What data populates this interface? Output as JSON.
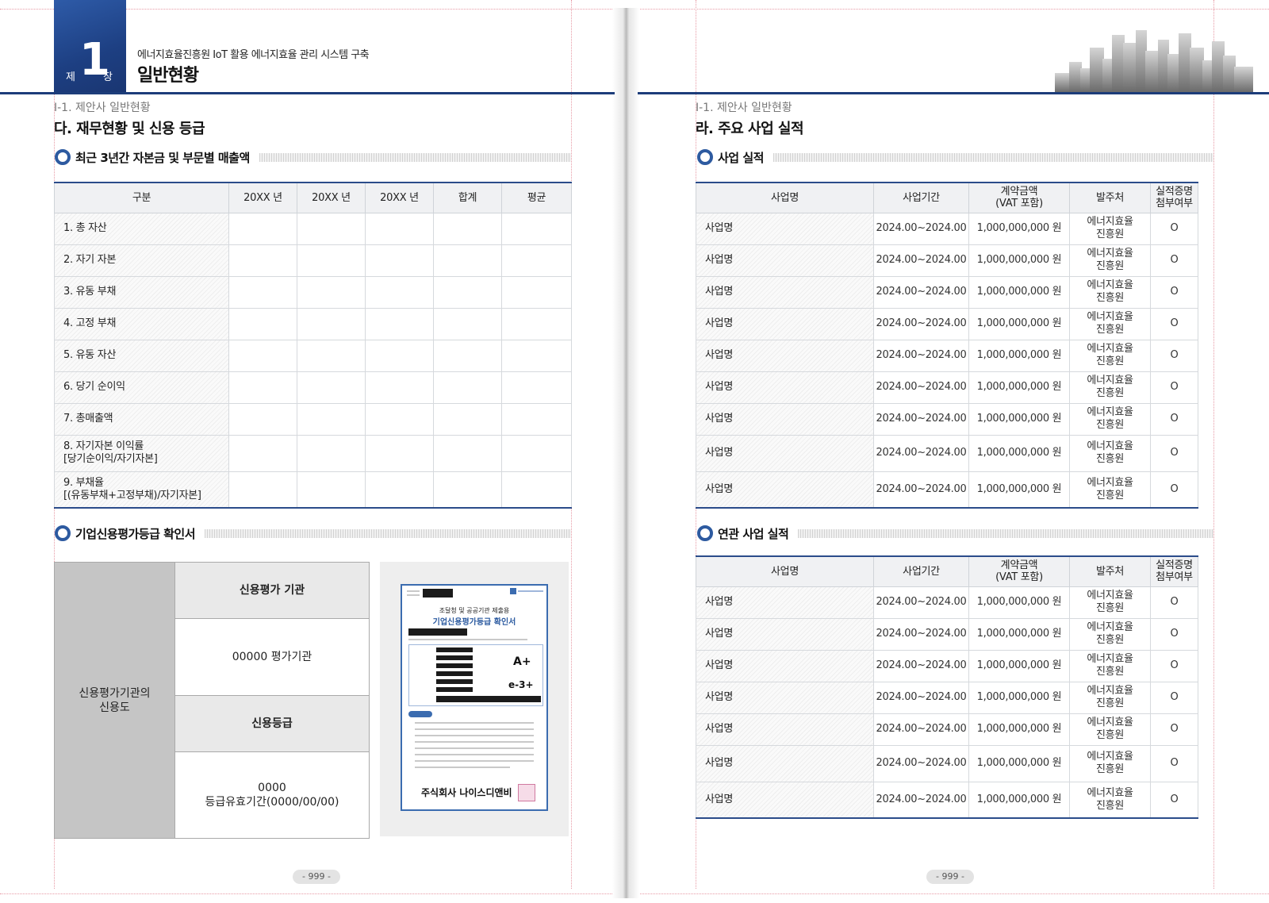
{
  "header": {
    "chapter_prefix": "제",
    "chapter_number": "1",
    "chapter_suffix": "장",
    "subtitle": "에너지효율진흥원  IoT 활용 에너지효율 관리 시스템 구축",
    "title": "일반현황"
  },
  "left": {
    "breadcrumb": "Ⅰ-1. 제안사 일반현황",
    "section_title": "다. 재무현황 및 신용 등급",
    "finance": {
      "heading": "최근 3년간 자본금 및 부문별 매출액",
      "columns": [
        "구분",
        "20XX 년",
        "20XX 년",
        "20XX 년",
        "합계",
        "평균"
      ],
      "rows": [
        {
          "l1": "1. 총 자산",
          "l2": ""
        },
        {
          "l1": "2. 자기 자본",
          "l2": ""
        },
        {
          "l1": "3. 유동 부채",
          "l2": ""
        },
        {
          "l1": "4. 고정 부채",
          "l2": ""
        },
        {
          "l1": "5. 유동 자산",
          "l2": ""
        },
        {
          "l1": "6. 당기 순이익",
          "l2": ""
        },
        {
          "l1": "7. 총매출액",
          "l2": ""
        },
        {
          "l1": "8. 자기자본 이익률",
          "l2": "[당기순이익/자기자본]"
        },
        {
          "l1": "9. 부채율",
          "l2": "[(유동부채+고정부채)/자기자본]"
        }
      ]
    },
    "credit": {
      "heading": "기업신용평가등급 확인서",
      "left_l1": "신용평가기관의",
      "left_l2": "신용도",
      "agency_head": "신용평가 기관",
      "agency_value": "00000 평가기관",
      "grade_head": "신용등급",
      "grade_l1": "0000",
      "grade_l2": "등급유효기간(0000/00/00)"
    },
    "certificate": {
      "title_line1": "조달청 및 공공기관 제출용",
      "title_line2": "기업신용평가등급 확인서",
      "grade1": "A+",
      "grade2": "e-3+",
      "company": "주식회사 나이스디앤비"
    },
    "page_number": "- 999 -"
  },
  "right": {
    "breadcrumb": "Ⅰ-1. 제안사 일반현황",
    "section_title": "라. 주요 사업 실적",
    "business": {
      "heading": "사업 실적",
      "columns": [
        {
          "l1": "사업명",
          "l2": ""
        },
        {
          "l1": "사업기간",
          "l2": ""
        },
        {
          "l1": "계약금액",
          "l2": "(VAT 포함)"
        },
        {
          "l1": "발주처",
          "l2": ""
        },
        {
          "l1": "실적증명",
          "l2": "첨부여부"
        }
      ],
      "rows": [
        {
          "name": "사업명",
          "period": "2024.00~2024.00",
          "amount": "1,000,000,000 원",
          "client_l1": "에너지효율",
          "client_l2": "진흥원",
          "attached": "O"
        },
        {
          "name": "사업명",
          "period": "2024.00~2024.00",
          "amount": "1,000,000,000 원",
          "client_l1": "에너지효율",
          "client_l2": "진흥원",
          "attached": "O"
        },
        {
          "name": "사업명",
          "period": "2024.00~2024.00",
          "amount": "1,000,000,000 원",
          "client_l1": "에너지효율",
          "client_l2": "진흥원",
          "attached": "O"
        },
        {
          "name": "사업명",
          "period": "2024.00~2024.00",
          "amount": "1,000,000,000 원",
          "client_l1": "에너지효율",
          "client_l2": "진흥원",
          "attached": "O"
        },
        {
          "name": "사업명",
          "period": "2024.00~2024.00",
          "amount": "1,000,000,000 원",
          "client_l1": "에너지효율",
          "client_l2": "진흥원",
          "attached": "O"
        },
        {
          "name": "사업명",
          "period": "2024.00~2024.00",
          "amount": "1,000,000,000 원",
          "client_l1": "에너지효율",
          "client_l2": "진흥원",
          "attached": "O"
        },
        {
          "name": "사업명",
          "period": "2024.00~2024.00",
          "amount": "1,000,000,000 원",
          "client_l1": "에너지효율",
          "client_l2": "진흥원",
          "attached": "O"
        },
        {
          "name": "사업명",
          "period": "2024.00~2024.00",
          "amount": "1,000,000,000 원",
          "client_l1": "에너지효율",
          "client_l2": "진흥원",
          "attached": "O"
        },
        {
          "name": "사업명",
          "period": "2024.00~2024.00",
          "amount": "1,000,000,000 원",
          "client_l1": "에너지효율",
          "client_l2": "진흥원",
          "attached": "O"
        }
      ]
    },
    "related": {
      "heading": "연관 사업 실적",
      "columns": [
        {
          "l1": "사업명",
          "l2": ""
        },
        {
          "l1": "사업기간",
          "l2": ""
        },
        {
          "l1": "계약금액",
          "l2": "(VAT 포함)"
        },
        {
          "l1": "발주처",
          "l2": ""
        },
        {
          "l1": "실적증명",
          "l2": "첨부여부"
        }
      ],
      "rows": [
        {
          "name": "사업명",
          "period": "2024.00~2024.00",
          "amount": "1,000,000,000 원",
          "client_l1": "에너지효율",
          "client_l2": "진흥원",
          "attached": "O"
        },
        {
          "name": "사업명",
          "period": "2024.00~2024.00",
          "amount": "1,000,000,000 원",
          "client_l1": "에너지효율",
          "client_l2": "진흥원",
          "attached": "O"
        },
        {
          "name": "사업명",
          "period": "2024.00~2024.00",
          "amount": "1,000,000,000 원",
          "client_l1": "에너지효율",
          "client_l2": "진흥원",
          "attached": "O"
        },
        {
          "name": "사업명",
          "period": "2024.00~2024.00",
          "amount": "1,000,000,000 원",
          "client_l1": "에너지효율",
          "client_l2": "진흥원",
          "attached": "O"
        },
        {
          "name": "사업명",
          "period": "2024.00~2024.00",
          "amount": "1,000,000,000 원",
          "client_l1": "에너지효율",
          "client_l2": "진흥원",
          "attached": "O"
        },
        {
          "name": "사업명",
          "period": "2024.00~2024.00",
          "amount": "1,000,000,000 원",
          "client_l1": "에너지효율",
          "client_l2": "진흥원",
          "attached": "O"
        },
        {
          "name": "사업명",
          "period": "2024.00~2024.00",
          "amount": "1,000,000,000 원",
          "client_l1": "에너지효율",
          "client_l2": "진흥원",
          "attached": "O"
        }
      ]
    },
    "page_number": "- 999 -"
  },
  "colors": {
    "brand_blue": "#1d3d7a",
    "accent_blue": "#2d5aa0",
    "guide_pink": "#e79aa5"
  }
}
